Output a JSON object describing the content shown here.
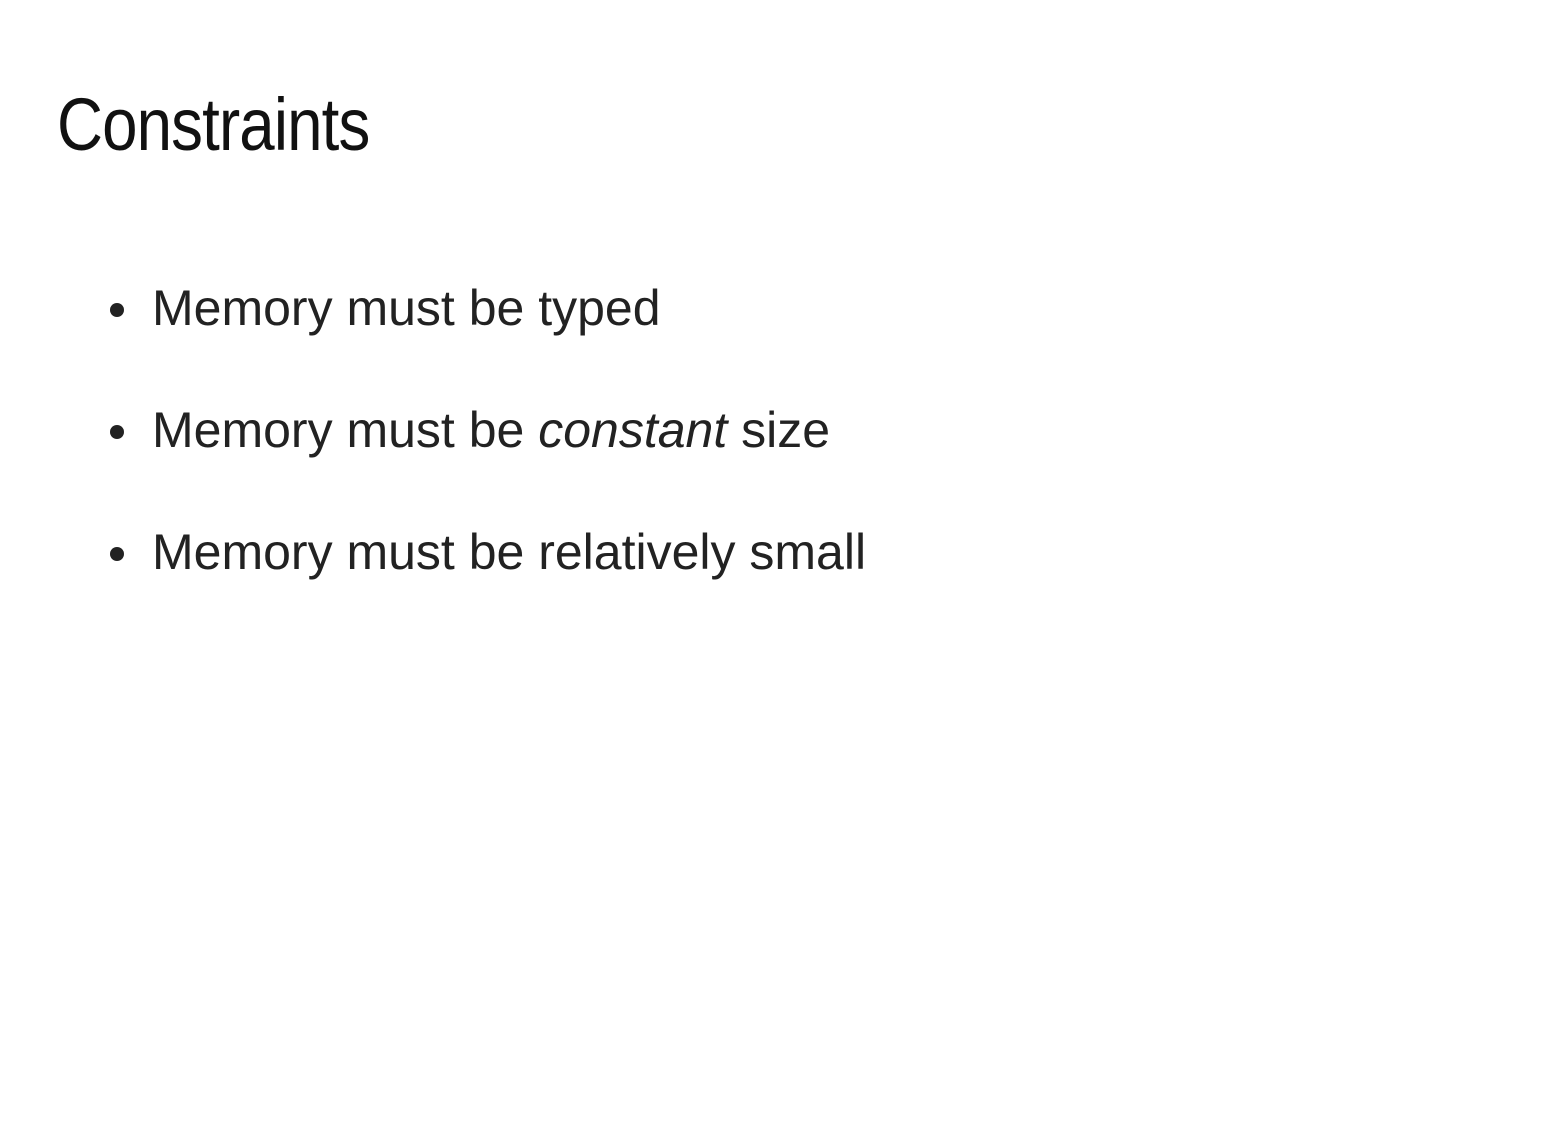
{
  "slide": {
    "title": "Constraints",
    "bullets": [
      {
        "before": "Memory must be typed",
        "emphasis": "",
        "after": ""
      },
      {
        "before": "Memory must be ",
        "emphasis": "constant",
        "after": " size"
      },
      {
        "before": "Memory must be relatively small",
        "emphasis": "",
        "after": ""
      }
    ]
  }
}
